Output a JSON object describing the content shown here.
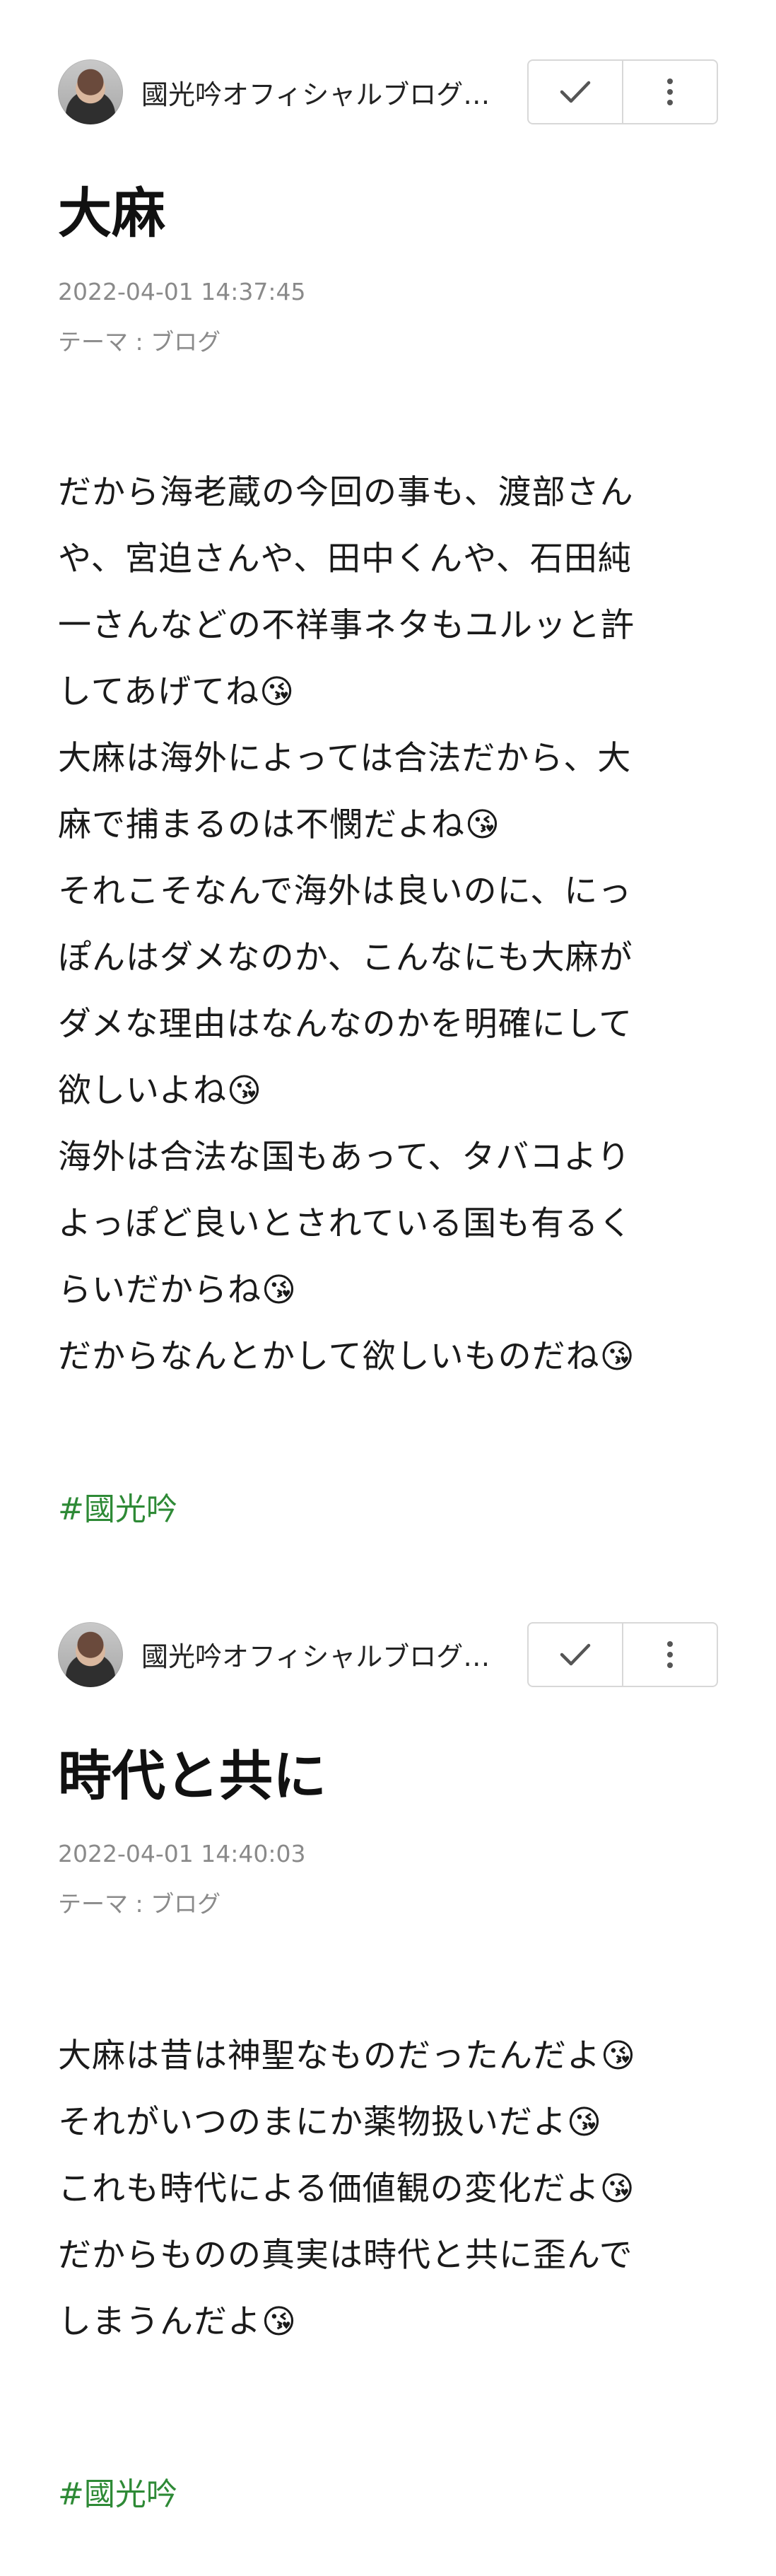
{
  "posts": [
    {
      "author": "國光吟オフィシャルブログ…",
      "title": "大麻",
      "date": "2022-04-01 14:37:45",
      "theme": "テーマ : ブログ",
      "body_lines": [
        "だから海老蔵の今回の事も、渡部さん",
        "や、宮迫さんや、田中くんや、石田純",
        "一さんなどの不祥事ネタもユルッと許",
        "してあげてね😘",
        "大麻は海外によっては合法だから、大",
        "麻で捕まるのは不憫だよね😘",
        "それこそなんで海外は良いのに、にっ",
        "ぽんはダメなのか、こんなにも大麻が",
        "ダメな理由はなんなのかを明確にして",
        "欲しいよね😘",
        "海外は合法な国もあって、タバコより",
        "よっぽど良いとされている国も有るく",
        "らいだからね😘",
        "だからなんとかして欲しいものだね😘"
      ],
      "hashtag": "#國光吟"
    },
    {
      "author": "國光吟オフィシャルブログ…",
      "title": "時代と共に",
      "date": "2022-04-01 14:40:03",
      "theme": "テーマ : ブログ",
      "body_lines": [
        "大麻は昔は神聖なものだったんだよ😘",
        "それがいつのまにか薬物扱いだよ😘",
        "これも時代による価値観の変化だよ😘",
        "だからものの真実は時代と共に歪んで",
        "しまうんだよ😘"
      ],
      "hashtag": "#國光吟"
    }
  ],
  "icons": {
    "check": "check-icon",
    "more": "more-vertical-icon"
  },
  "colors": {
    "hashtag": "#2e8a36",
    "meta": "#8a8a8a",
    "border": "#d8d8d8"
  }
}
